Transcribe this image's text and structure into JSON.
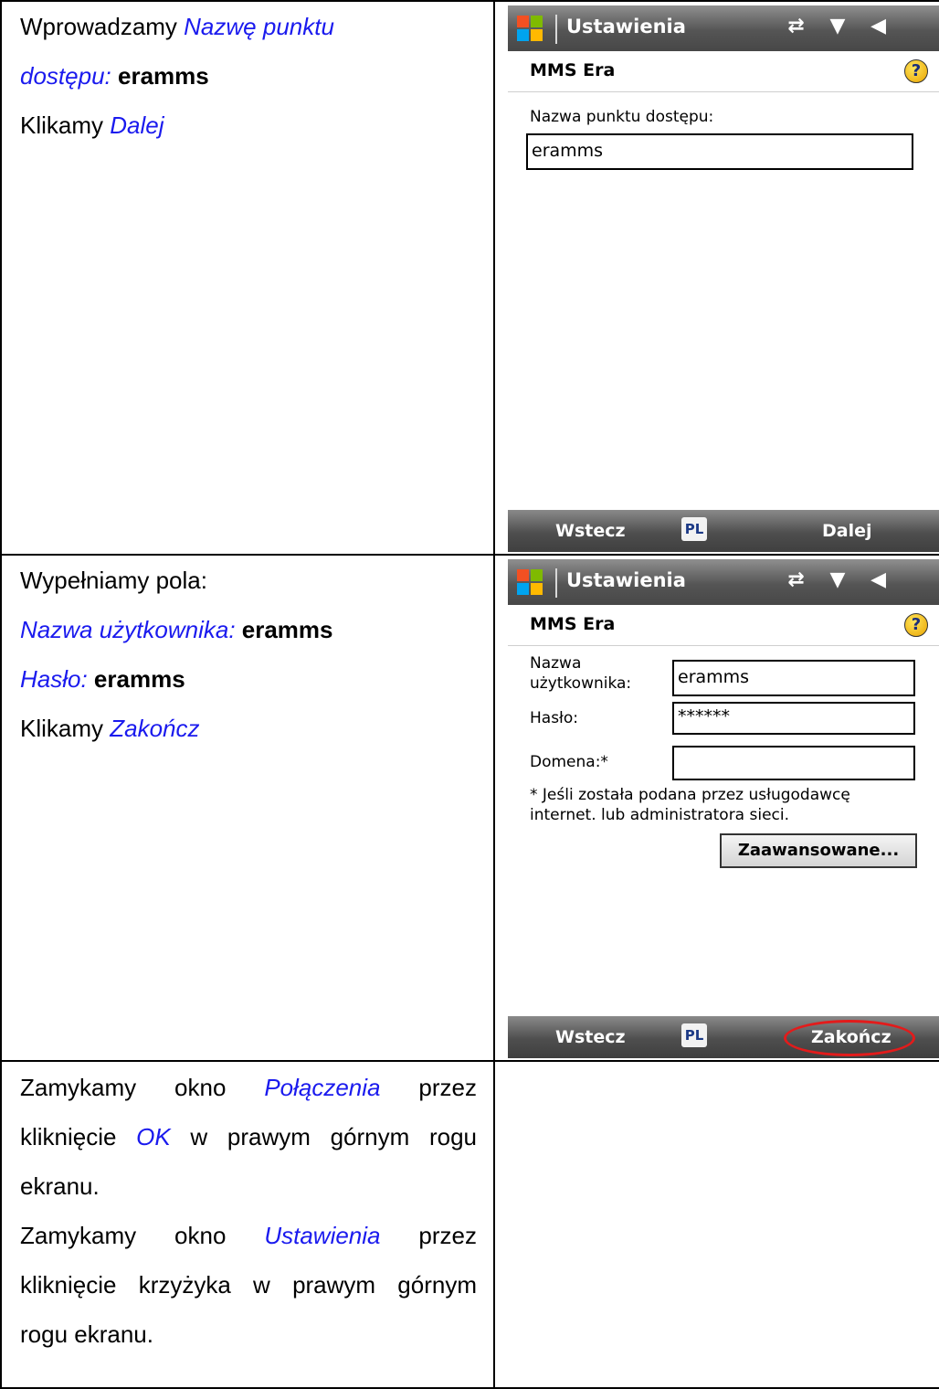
{
  "rows": [
    {
      "instr": {
        "lines": [
          {
            "parts": [
              {
                "t": "Wprowadzamy ",
                "s": "plain"
              },
              {
                "t": "Nazwę punktu",
                "s": "kw"
              }
            ]
          },
          {
            "parts": [
              {
                "t": "dostępu: ",
                "s": "kw"
              },
              {
                "t": "eramms",
                "s": "val"
              }
            ]
          },
          {
            "parts": [
              {
                "t": "Klikamy ",
                "s": "plain"
              },
              {
                "t": "Dalej",
                "s": "kw"
              }
            ]
          }
        ]
      },
      "screen": {
        "title": "Ustawienia",
        "subtitle": "MMS Era",
        "field_label": "Nazwa punktu dostępu:",
        "field_value": "eramms",
        "left_softkey": "Wstecz",
        "input_method": "PL",
        "right_softkey": "Dalej"
      }
    },
    {
      "instr": {
        "lines": [
          {
            "parts": [
              {
                "t": "Wypełniamy pola:",
                "s": "plain"
              }
            ]
          },
          {
            "parts": [
              {
                "t": "Nazwa użytkownika: ",
                "s": "kw"
              },
              {
                "t": "eramms",
                "s": "val"
              }
            ]
          },
          {
            "parts": [
              {
                "t": "Hasło: ",
                "s": "kw"
              },
              {
                "t": "eramms",
                "s": "val"
              }
            ]
          },
          {
            "parts": [
              {
                "t": "Klikamy ",
                "s": "plain"
              },
              {
                "t": "Zakończ",
                "s": "kw"
              }
            ]
          }
        ]
      },
      "screen": {
        "title": "Ustawienia",
        "subtitle": "MMS Era",
        "username_label_1": "Nazwa",
        "username_label_2": "użytkownika:",
        "username_value": "eramms",
        "password_label": "Hasło:",
        "password_value": "******",
        "domain_label": "Domena:*",
        "domain_value": "",
        "note_1": "* Jeśli została podana przez usługodawcę",
        "note_2": "internet. lub administratora sieci.",
        "advanced_button": "Zaawansowane...",
        "left_softkey": "Wstecz",
        "input_method": "PL",
        "right_softkey": "Zakończ"
      }
    },
    {
      "instr": {
        "lines": [
          {
            "parts": [
              {
                "t": "Zamykamy okno ",
                "s": "plain"
              },
              {
                "t": "Połączenia",
                "s": "kw"
              },
              {
                "t": " przez",
                "s": "plain"
              }
            ],
            "justify": true
          },
          {
            "parts": [
              {
                "t": "kliknięcie ",
                "s": "plain"
              },
              {
                "t": "OK",
                "s": "kw"
              },
              {
                "t": " w prawym górnym rogu",
                "s": "plain"
              }
            ],
            "justify": true
          },
          {
            "parts": [
              {
                "t": "ekranu.",
                "s": "plain"
              }
            ]
          },
          {
            "parts": [
              {
                "t": "Zamykamy okno ",
                "s": "plain"
              },
              {
                "t": "Ustawienia",
                "s": "kw"
              },
              {
                "t": " przez",
                "s": "plain"
              }
            ],
            "justify": true
          },
          {
            "parts": [
              {
                "t": "kliknięcie krzyżyka w prawym górnym",
                "s": "plain"
              }
            ],
            "justify": true
          },
          {
            "parts": [
              {
                "t": "rogu ekranu.",
                "s": "plain"
              }
            ]
          }
        ]
      }
    }
  ],
  "icons": {
    "windows_logo": "windows-logo-icon",
    "status": "⇄ ▼ ◀",
    "help": "?"
  }
}
